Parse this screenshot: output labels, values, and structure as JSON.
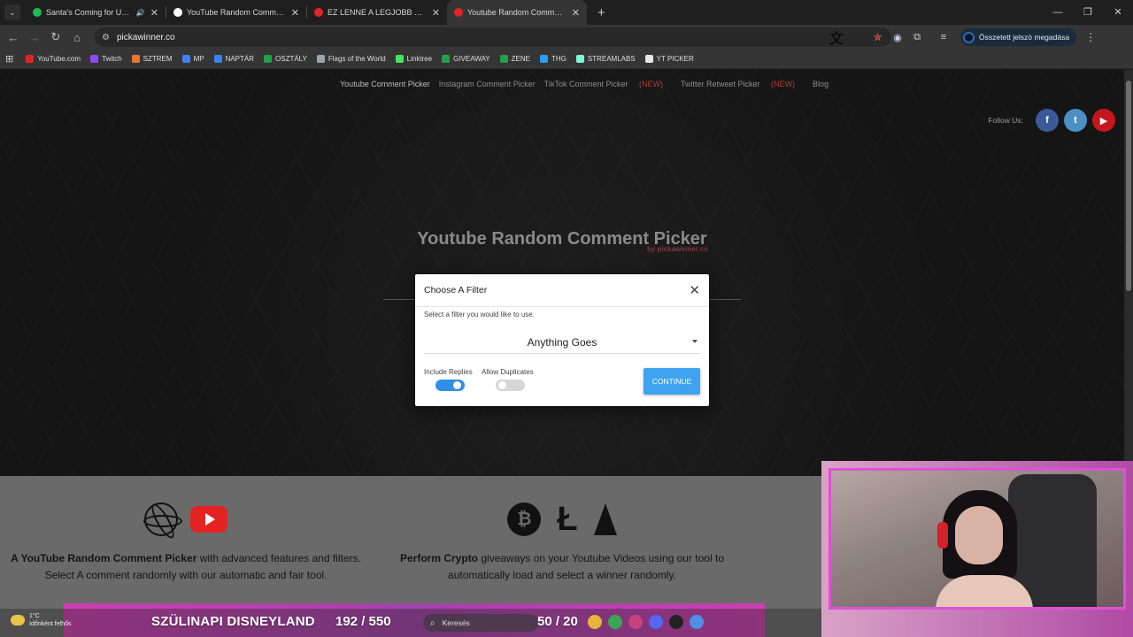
{
  "browser": {
    "tabs": [
      {
        "title": "Santa's Coming for Us • Sia",
        "favicon_color": "#1db954",
        "active": false,
        "audio": true
      },
      {
        "title": "YouTube Random Comment Pic",
        "favicon_color": "#ffffff",
        "active": false,
        "audio": false
      },
      {
        "title": "EZ LENNE A LEGJOBB KARÁCSO",
        "favicon_color": "#e02424",
        "active": false,
        "audio": false
      },
      {
        "title": "Youtube Random Comment Pic",
        "favicon_color": "#e02424",
        "active": true,
        "audio": false
      }
    ],
    "url": "pickawinner.co",
    "profile_label": "Összetett jelszó megadása",
    "bookmarks": [
      {
        "label": "YouTube.com",
        "color": "#e02424"
      },
      {
        "label": "Twitch",
        "color": "#9146ff"
      },
      {
        "label": "SZTREM",
        "color": "#e8772e"
      },
      {
        "label": "MP",
        "color": "#3b82f6"
      },
      {
        "label": "NAPTÁR",
        "color": "#3b82f6"
      },
      {
        "label": "OSZTÁLY",
        "color": "#22a04a"
      },
      {
        "label": "Flags of the World",
        "color": "#9ca3af"
      },
      {
        "label": "Linktree",
        "color": "#43e660"
      },
      {
        "label": "GIVEAWAY",
        "color": "#22a04a"
      },
      {
        "label": "ZENE",
        "color": "#22a04a"
      },
      {
        "label": "THG",
        "color": "#2a9df4"
      },
      {
        "label": "STREAMLABS",
        "color": "#80f5d2"
      },
      {
        "label": "YT PICKER",
        "color": "#e6e6e6"
      }
    ]
  },
  "site": {
    "nav": {
      "youtube": "Youtube Comment Picker",
      "instagram": "Instagram Comment Picker",
      "tiktok": "TikTok Comment Picker",
      "tiktok_badge": "(NEW)",
      "twitter": "Twitter Retweet Picker",
      "twitter_badge": "(NEW)",
      "blog": "Blog"
    },
    "follow_label": "Follow Us:",
    "social": {
      "facebook": "f",
      "twitter": "t",
      "youtube": "▶"
    },
    "hero_title": "Youtube Random Comment Picker",
    "hero_sub": "by pickawinner.co",
    "features": {
      "left_bold": "A YouTube Random Comment Picker",
      "left_rest": " with advanced features and filters.",
      "left_line2": "Select A comment randomly with our automatic and fair tool.",
      "right_bold": "Perform Crypto",
      "right_rest": " giveaways on your Youtube Videos using our tool to",
      "right_line2": "automatically load and select a winner randomly."
    }
  },
  "modal": {
    "title": "Choose A Filter",
    "close": "✕",
    "description": "Select a filter you would like to use.",
    "filter_value": "Anything Goes",
    "include_replies_label": "Include Replies",
    "include_replies": true,
    "allow_duplicates_label": "Allow Duplicates",
    "allow_duplicates": false,
    "continue_label": "CONTINUE"
  },
  "overlay": {
    "weather_temp": "1°C",
    "weather_desc": "Időnként felhős",
    "ticker": "SZÜLINAPI DISNEYLAND",
    "count1": "192 / 550",
    "count2": "50 / 20",
    "search_placeholder": "Keresés"
  }
}
